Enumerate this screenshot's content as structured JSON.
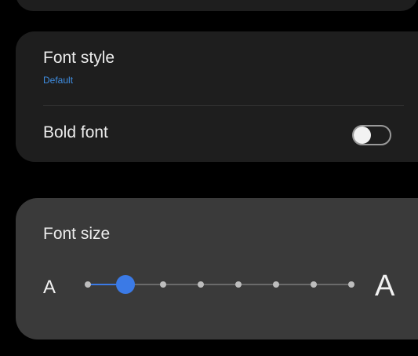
{
  "settings": {
    "font_style": {
      "title": "Font style",
      "value": "Default"
    },
    "bold_font": {
      "title": "Bold font",
      "enabled": false
    },
    "font_size": {
      "title": "Font size",
      "small_label": "A",
      "large_label": "A",
      "steps": 8,
      "selected_step": 2
    }
  },
  "colors": {
    "accent": "#3b7ae6",
    "subtitle": "#3f8de0",
    "card": "#1e1e1e",
    "card_active": "#3a3a3a",
    "background": "#000000"
  }
}
